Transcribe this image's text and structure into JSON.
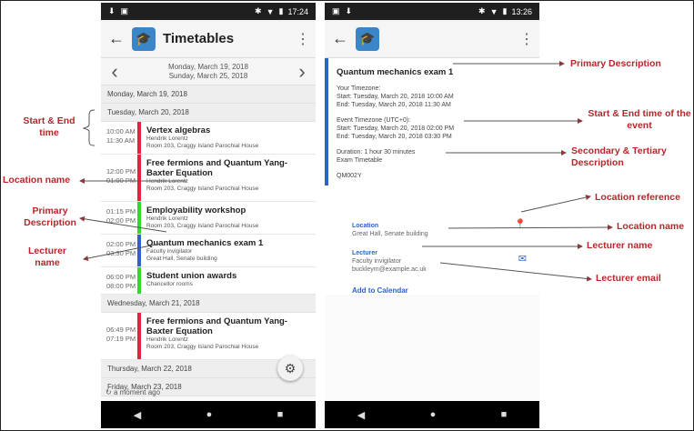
{
  "phone1": {
    "status_time": "17:24",
    "title": "Timetables",
    "week_start": "Monday, March 19, 2018",
    "week_end": "Sunday, March 25, 2018",
    "days": [
      {
        "header": "Monday, March 19, 2018"
      },
      {
        "header": "Tuesday, March 20, 2018"
      }
    ],
    "events": [
      {
        "start": "10:00 AM",
        "end": "11:30 AM",
        "title": "Vertex algebras",
        "lecturer": "Hendrik Lorentz",
        "location": "Room 203, Craggy Island Parochial House",
        "color": "#e8203f"
      },
      {
        "start": "12:00 PM",
        "end": "01:00 PM",
        "title": "Free fermions and Quantum Yang-Baxter Equation",
        "lecturer": "Hendrik Lorentz",
        "location": "Room 203, Craggy Island Parochial House",
        "color": "#e8203f"
      },
      {
        "start": "01:15 PM",
        "end": "02:00 PM",
        "title": "Employability workshop",
        "lecturer": "Hendrik Lorentz",
        "location": "Room 203, Craggy Island Parochial House",
        "color": "#35d62f"
      },
      {
        "start": "02:00 PM",
        "end": "03:30 PM",
        "title": "Quantum mechanics exam 1",
        "lecturer": "Faculty invigilator",
        "location": "Great Hall, Senate building",
        "color": "#2d63c8"
      },
      {
        "start": "06:00 PM",
        "end": "08:00 PM",
        "title": "Student union awards",
        "lecturer": "Chancellor rooms",
        "location": "",
        "color": "#35d62f"
      }
    ],
    "day3_header": "Wednesday, March 21, 2018",
    "event6": {
      "start": "06:49 PM",
      "end": "07:19 PM",
      "title": "Free fermions and Quantum Yang-Baxter Equation",
      "lecturer": "Hendrik Lorentz",
      "location": "Room 203, Craggy Island Parochial House",
      "color": "#e8203f"
    },
    "day4_header": "Thursday, March 22, 2018",
    "day5_header": "Friday, March 23, 2018",
    "refresh_text": "a moment ago"
  },
  "phone2": {
    "status_time": "13:26",
    "title": "Quantum mechanics exam 1",
    "your_tz_label": "Your Timezone:",
    "your_start": "Start: Tuesday, March 20, 2018 10:00 AM",
    "your_end": "End: Tuesday, March 20, 2018 11:30 AM",
    "event_tz_label": "Event Timezone (UTC+0):",
    "event_start": "Start: Tuesday, March 20, 2018 02:00 PM",
    "event_end": "End: Tuesday, March 20, 2018 03:30 PM",
    "duration": "Duration: 1 hour 30 minutes",
    "secondary": "Exam Timetable",
    "code": "QM002Y",
    "location_label": "Location",
    "location_value": "Great Hall, Senate building",
    "lecturer_label": "Lecturer",
    "lecturer_name": "Faculty invigilator",
    "lecturer_email": "buckleym@example.ac.uk",
    "add_calendar": "Add to Calendar"
  },
  "annotations": {
    "start_end_time": "Start & End time",
    "location_name_left": "Location name",
    "primary_desc_left": "Primary Description",
    "lecturer_name_left": "Lecturer name",
    "primary_desc_right": "Primary Description",
    "start_end_event": "Start & End time of the event",
    "secondary_tertiary": "Secondary & Tertiary Description",
    "location_reference": "Location reference",
    "location_name_right": "Location name",
    "lecturer_name_right": "Lecturer name",
    "lecturer_email": "Lecturer email"
  }
}
